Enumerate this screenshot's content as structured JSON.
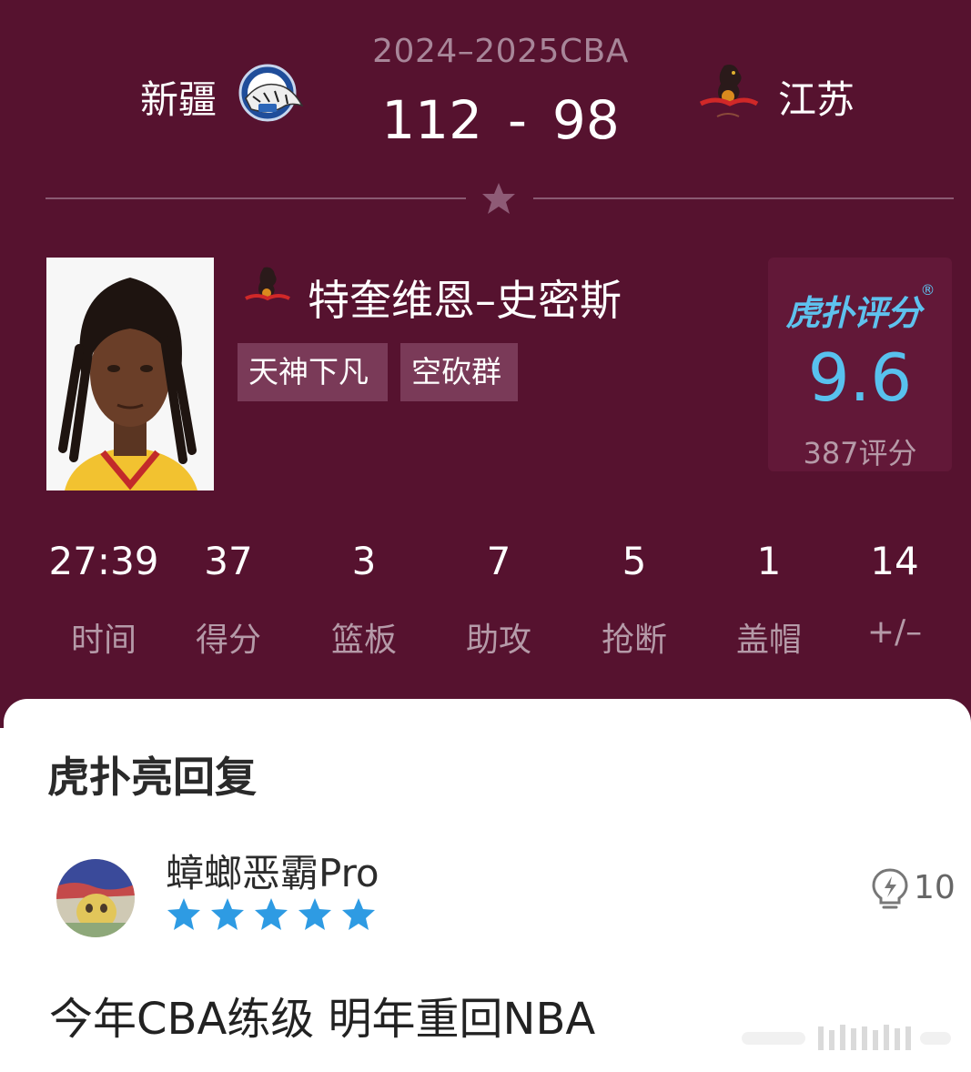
{
  "match": {
    "season": "2024–2025CBA",
    "home_team": "新疆",
    "away_team": "江苏",
    "home_score": "112",
    "separator": "-",
    "away_score": "98"
  },
  "player": {
    "name": "特奎维恩–史密斯",
    "tags": [
      "天神下凡",
      "空砍群"
    ]
  },
  "rating": {
    "brand": "虎扑评分",
    "registered": "®",
    "score": "9.6",
    "count": "387评分"
  },
  "stats": [
    {
      "value": "27:39",
      "label": "时间"
    },
    {
      "value": "37",
      "label": "得分"
    },
    {
      "value": "3",
      "label": "篮板"
    },
    {
      "value": "7",
      "label": "助攻"
    },
    {
      "value": "5",
      "label": "抢断"
    },
    {
      "value": "1",
      "label": "盖帽"
    },
    {
      "value": "14",
      "label": "+/–"
    }
  ],
  "replies": {
    "title": "虎扑亮回复",
    "items": [
      {
        "username": "蟑螂恶霸Pro",
        "star_rating": 5,
        "likes": "10",
        "text": "今年CBA练级 明年重回NBA"
      }
    ]
  },
  "colors": {
    "hero_bg": "#56122f",
    "accent_blue": "#58c1ee",
    "tag_bg": "#7a3a58",
    "star_blue": "#2e9be3"
  },
  "icons": {
    "divider": "star-icon",
    "like": "lightbulb-icon",
    "rating_star": "star-icon"
  }
}
